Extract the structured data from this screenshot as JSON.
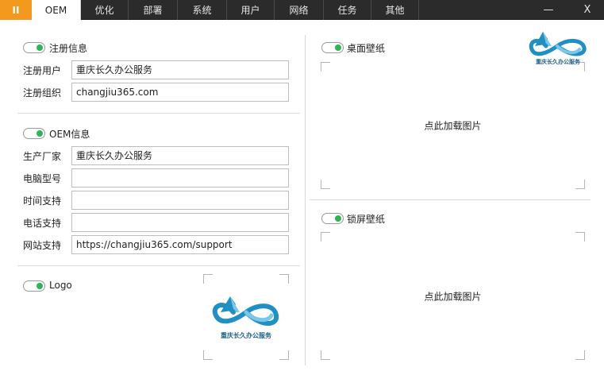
{
  "topbar": {
    "pause_label": "II",
    "tabs": [
      {
        "label": "OEM",
        "active": true
      },
      {
        "label": "优化",
        "active": false
      },
      {
        "label": "部署",
        "active": false
      },
      {
        "label": "系统",
        "active": false
      },
      {
        "label": "用户",
        "active": false
      },
      {
        "label": "网络",
        "active": false
      },
      {
        "label": "任务",
        "active": false
      },
      {
        "label": "其他",
        "active": false
      }
    ],
    "minimize_label": "—",
    "close_label": "X"
  },
  "registration": {
    "title": "注册信息",
    "enabled": true,
    "fields": [
      {
        "label": "注册用户",
        "value": "重庆长久办公服务"
      },
      {
        "label": "注册组织",
        "value": "changjiu365.com"
      }
    ]
  },
  "oem": {
    "title": "OEM信息",
    "enabled": true,
    "fields": [
      {
        "label": "生产厂家",
        "value": "重庆长久办公服务"
      },
      {
        "label": "电脑型号",
        "value": ""
      },
      {
        "label": "时间支持",
        "value": ""
      },
      {
        "label": "电话支持",
        "value": ""
      },
      {
        "label": "网站支持",
        "value": "https://changjiu365.com/support"
      }
    ]
  },
  "logo_section": {
    "title": "Logo",
    "enabled": true,
    "logo_text": "重庆长久办公服务"
  },
  "desktop_wallpaper": {
    "title": "桌面壁纸",
    "enabled": true,
    "placeholder": "点此加载图片"
  },
  "lock_wallpaper": {
    "title": "锁屏壁纸",
    "enabled": true,
    "placeholder": "点此加载图片"
  },
  "brand": {
    "logo_text": "重庆长久办公服务",
    "accent": "#f39a1e",
    "toggle_on": "#2fb35a",
    "logo_blue": "#1f8fc4",
    "logo_light": "#7cc7e8"
  }
}
